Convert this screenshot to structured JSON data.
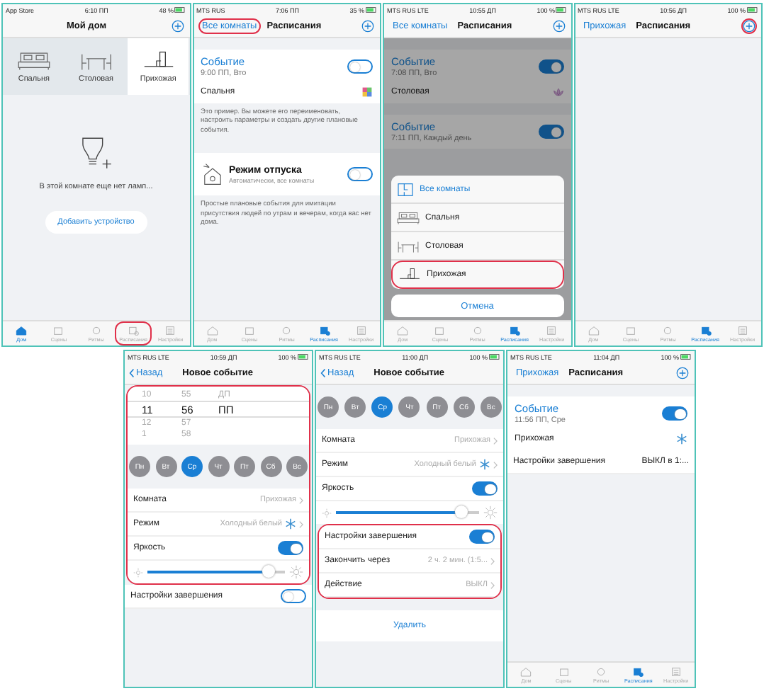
{
  "panels": [
    {
      "status": {
        "carrier": "App Store",
        "time": "6:10 ПП",
        "battery": "48 %"
      },
      "nav": {
        "title": "Мой дом",
        "plus": true,
        "plus_highlight": false
      },
      "body": [
        {
          "kind": "rooms",
          "items": [
            {
              "label": "Спальня",
              "selected": false
            },
            {
              "label": "Столовая",
              "selected": false
            },
            {
              "label": "Прихожая",
              "selected": true
            }
          ]
        },
        {
          "kind": "empty",
          "text": "В этой комнате еще нет ламп...",
          "button": "Добавить устройство"
        }
      ],
      "tabbar": [
        {
          "label": "Дом",
          "selected": true,
          "highlight": false
        },
        {
          "label": "Сцены",
          "selected": false,
          "highlight": false
        },
        {
          "label": "Ритмы",
          "selected": false,
          "highlight": false
        },
        {
          "label": "Расписания",
          "selected": false,
          "highlight": true
        },
        {
          "label": "Настройки",
          "selected": false,
          "highlight": false
        }
      ]
    },
    {
      "status": {
        "carrier": "MTS RUS",
        "time": "7:06 ПП",
        "battery": "35 %"
      },
      "nav": {
        "link": "Все комнаты",
        "link_highlight": true,
        "title": "Расписания",
        "plus": true,
        "plus_highlight": false
      },
      "body": [
        {
          "kind": "event",
          "title": "Событие",
          "time": "9:00 ПП, Вто",
          "on": false,
          "room": "Спальня"
        },
        {
          "kind": "note",
          "text": "Это пример. Вы можете его переименовать, настроить параметры и создать другие плановые события."
        },
        {
          "kind": "vacation",
          "title": "Режим отпуска",
          "subtitle": "Автоматически, все комнаты",
          "on": false
        },
        {
          "kind": "note",
          "text": "Простые плановые события для имитации присутствия людей по утрам и вечерам, когда вас нет дома."
        }
      ],
      "tabbar": [
        {
          "label": "Дом",
          "selected": false,
          "highlight": false
        },
        {
          "label": "Сцены",
          "selected": false,
          "highlight": false
        },
        {
          "label": "Ритмы",
          "selected": false,
          "highlight": false
        },
        {
          "label": "Расписания",
          "selected": true,
          "highlight": false
        },
        {
          "label": "Настройки",
          "selected": false,
          "highlight": false
        }
      ]
    },
    {
      "status": {
        "carrier": "MTS RUS LTE",
        "time": "10:55 ДП",
        "battery": "100 %"
      },
      "nav": {
        "link": "Все комнаты",
        "link_highlight": false,
        "title": "Расписания",
        "plus": true,
        "plus_highlight": false
      },
      "body": [
        {
          "kind": "event",
          "title": "Событие",
          "time": "7:08 ПП, Вто",
          "on": true,
          "room": "Столовая"
        },
        {
          "kind": "event",
          "title": "Событие",
          "time": "7:11 ПП, Каждый день",
          "on": true
        }
      ],
      "sheet": {
        "options": [
          {
            "label": "Все комнаты",
            "highlight": false
          },
          {
            "label": "Спальня",
            "highlight": false
          },
          {
            "label": "Столовая",
            "highlight": false
          },
          {
            "label": "Прихожая",
            "highlight": true
          }
        ],
        "cancel": "Отмена"
      },
      "tabbar": [
        {
          "label": "Дом",
          "selected": false,
          "highlight": false
        },
        {
          "label": "Сцены",
          "selected": false,
          "highlight": false
        },
        {
          "label": "Ритмы",
          "selected": false,
          "highlight": false
        },
        {
          "label": "Расписания",
          "selected": true,
          "highlight": false
        },
        {
          "label": "Настройки",
          "selected": false,
          "highlight": false
        }
      ]
    },
    {
      "status": {
        "carrier": "MTS RUS LTE",
        "time": "10:56 ДП",
        "battery": "100 %"
      },
      "nav": {
        "link": "Прихожая",
        "link_highlight": false,
        "title": "Расписания",
        "plus": true,
        "plus_highlight": true
      },
      "tabbar": [
        {
          "label": "Дом",
          "selected": false,
          "highlight": false
        },
        {
          "label": "Сцены",
          "selected": false,
          "highlight": false
        },
        {
          "label": "Ритмы",
          "selected": false,
          "highlight": false
        },
        {
          "label": "Расписания",
          "selected": true,
          "highlight": false
        },
        {
          "label": "Настройки",
          "selected": false,
          "highlight": false
        }
      ]
    },
    {
      "status": {
        "carrier": "MTS RUS LTE",
        "time": "10:59 ДП",
        "battery": "100 %"
      },
      "nav": {
        "back": "Назад",
        "title": "Новое событие"
      },
      "body": [
        {
          "kind": "group",
          "highlight": true,
          "blocks": [
            {
              "kind": "picker",
              "rows": [
                {
                  "cells": [
                    "10",
                    "55",
                    "ДП"
                  ],
                  "selected": false
                },
                {
                  "cells": [
                    "11",
                    "56",
                    "ПП"
                  ],
                  "selected": true
                },
                {
                  "cells": [
                    "12",
                    "57"
                  ],
                  "selected": false
                },
                {
                  "cells": [
                    "1",
                    "58"
                  ],
                  "selected": false
                }
              ]
            },
            {
              "kind": "days",
              "items": [
                {
                  "label": "Пн",
                  "selected": false
                },
                {
                  "label": "Вт",
                  "selected": false
                },
                {
                  "label": "Ср",
                  "selected": true
                },
                {
                  "label": "Чт",
                  "selected": false
                },
                {
                  "label": "Пт",
                  "selected": false
                },
                {
                  "label": "Сб",
                  "selected": false
                },
                {
                  "label": "Вс",
                  "selected": false
                }
              ]
            },
            {
              "kind": "row",
              "label": "Комната",
              "value": "Прихожая",
              "chevron": true
            },
            {
              "kind": "row",
              "label": "Режим",
              "value": "Холодный белый",
              "snow": true,
              "chevron": true
            },
            {
              "kind": "row",
              "label": "Яркость",
              "on": true
            },
            {
              "kind": "slider",
              "level": 0.88
            }
          ]
        },
        {
          "kind": "row",
          "label": "Настройки завершения",
          "on": false
        }
      ]
    },
    {
      "status": {
        "carrier": "MTS RUS LTE",
        "time": "11:00 ДП",
        "battery": "100 %"
      },
      "nav": {
        "back": "Назад",
        "title": "Новое событие"
      },
      "body": [
        {
          "kind": "days",
          "items": [
            {
              "label": "Пн",
              "selected": false
            },
            {
              "label": "Вт",
              "selected": false
            },
            {
              "label": "Ср",
              "selected": true
            },
            {
              "label": "Чт",
              "selected": false
            },
            {
              "label": "Пт",
              "selected": false
            },
            {
              "label": "Сб",
              "selected": false
            },
            {
              "label": "Вс",
              "selected": false
            }
          ]
        },
        {
          "kind": "row",
          "label": "Комната",
          "value": "Прихожая",
          "chevron": true
        },
        {
          "kind": "row",
          "label": "Режим",
          "value": "Холодный белый",
          "snow": true,
          "chevron": true
        },
        {
          "kind": "row",
          "label": "Яркость",
          "on": true
        },
        {
          "kind": "slider",
          "level": 0.88
        },
        {
          "kind": "group",
          "highlight": true,
          "blocks": [
            {
              "kind": "row",
              "label": "Настройки завершения",
              "on": true
            },
            {
              "kind": "row",
              "label": "Закончить через",
              "value": "2 ч. 2 мин. (1:5...",
              "chevron": true
            },
            {
              "kind": "row",
              "label": "Действие",
              "value": "ВЫКЛ",
              "chevron": true
            }
          ]
        },
        {
          "kind": "link",
          "text": "Удалить"
        }
      ]
    },
    {
      "status": {
        "carrier": "MTS RUS LTE",
        "time": "11:04 ДП",
        "battery": "100 %"
      },
      "nav": {
        "link": "Прихожая",
        "link_highlight": false,
        "title": "Расписания",
        "plus": true,
        "plus_highlight": false
      },
      "body": [
        {
          "kind": "event",
          "title": "Событие",
          "time": "11:56 ПП, Сре",
          "on": true,
          "room": "Прихожая"
        },
        {
          "kind": "row",
          "label": "Настройки завершения",
          "value": "ВЫКЛ в 1:..."
        }
      ],
      "tabbar": [
        {
          "label": "Дом",
          "selected": false,
          "highlight": false
        },
        {
          "label": "Сцены",
          "selected": false,
          "highlight": false
        },
        {
          "label": "Ритмы",
          "selected": false,
          "highlight": false
        },
        {
          "label": "Расписания",
          "selected": true,
          "highlight": false
        },
        {
          "label": "Настройки",
          "selected": false,
          "highlight": false
        }
      ]
    }
  ]
}
